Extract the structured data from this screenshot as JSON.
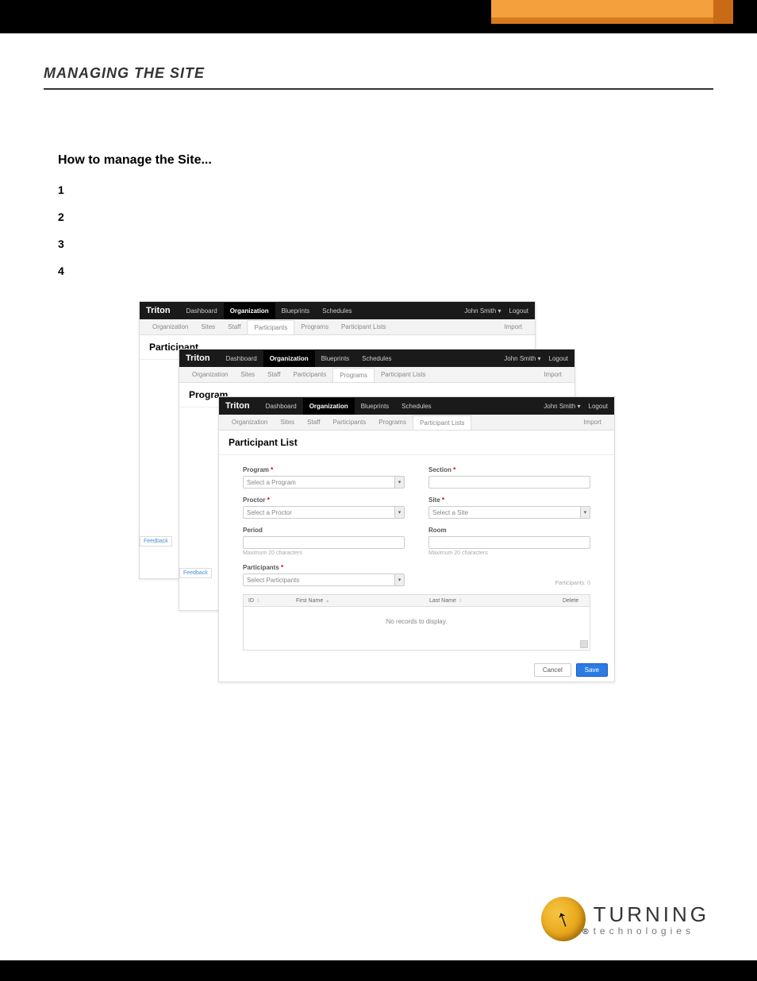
{
  "page": {
    "section_title": "MANAGING THE SITE",
    "howto_heading": "How to manage the Site...",
    "steps": [
      "1",
      "2",
      "3",
      "4"
    ]
  },
  "app": {
    "brand": "Triton",
    "top_nav": [
      "Dashboard",
      "Organization",
      "Blueprints",
      "Schedules"
    ],
    "top_nav_active": "Organization",
    "user": "John Smith",
    "user_caret": "▾",
    "logout": "Logout",
    "sub_nav": [
      "Organization",
      "Sites",
      "Staff",
      "Participants",
      "Programs",
      "Participant Lists"
    ],
    "import_label": "Import",
    "feedback_label": "Feedback"
  },
  "window1": {
    "page_header": "Participant",
    "sub_active": "Participants"
  },
  "window2": {
    "page_header": "Program",
    "sub_active": "Programs"
  },
  "window3": {
    "page_header": "Participant List",
    "sub_active": "Participant Lists",
    "fields": {
      "program_label": "Program",
      "program_placeholder": "Select a Program",
      "section_label": "Section",
      "proctor_label": "Proctor",
      "proctor_placeholder": "Select a Proctor",
      "site_label": "Site",
      "site_placeholder": "Select a Site",
      "period_label": "Period",
      "period_helper": "Maximum 20 characters",
      "room_label": "Room",
      "room_helper": "Maximum 20 characters",
      "participants_label": "Participants",
      "participants_placeholder": "Select Participants",
      "participants_count": "Participants: 0"
    },
    "grid": {
      "col_id": "ID",
      "col_first": "First Name",
      "col_last": "Last Name",
      "col_delete": "Delete",
      "empty": "No records to display."
    },
    "buttons": {
      "cancel": "Cancel",
      "save": "Save"
    }
  },
  "footer_logo": {
    "line1": "TURNING",
    "line2": "technologies"
  }
}
